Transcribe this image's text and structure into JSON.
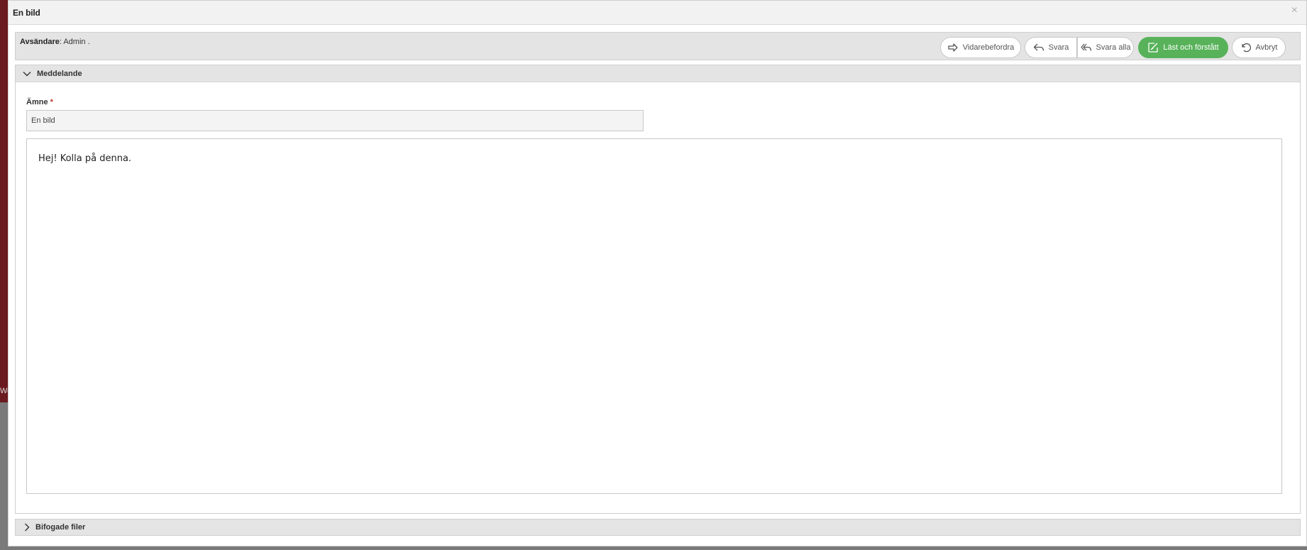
{
  "window": {
    "title": "En bild"
  },
  "backdrop": {
    "edge_text": "We"
  },
  "sender": {
    "label": "Avsändare",
    "value": ": Admin ."
  },
  "toolbar": {
    "forward_label": "Vidarebefordra",
    "reply_label": "Svara",
    "reply_all_label": "Svara alla",
    "read_label": "Läst och förstått",
    "cancel_label": "Avbryt"
  },
  "message_section": {
    "title": "Meddelande",
    "subject_label": "Ämne",
    "required_mark": "*",
    "subject_value": "En bild",
    "body_text": "Hej! Kolla på denna."
  },
  "attachments_section": {
    "title": "Bifogade filer"
  },
  "colors": {
    "accent_green": "#58b25a",
    "backdrop": "#6b1a1f"
  }
}
